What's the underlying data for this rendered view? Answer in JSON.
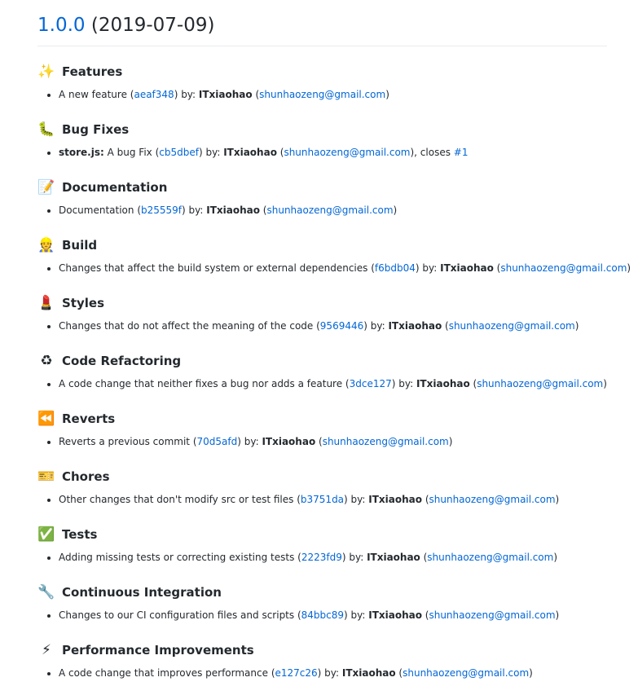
{
  "title": {
    "version": "1.0.0",
    "date": "(2019-07-09)"
  },
  "by_label": "by:",
  "closes_label": "closes",
  "link_color": "#0366d6",
  "sections": [
    {
      "icon": "sparkles-icon",
      "glyph": "✨",
      "heading": "Features",
      "items": [
        {
          "scope": "",
          "text": "A new feature",
          "hash": "aeaf348",
          "author": "ITxiaohao",
          "email": "shunhaozeng@gmail.com"
        }
      ]
    },
    {
      "icon": "bug-icon",
      "glyph": "🐛",
      "heading": "Bug Fixes",
      "items": [
        {
          "scope": "store.js:",
          "text": "A bug Fix",
          "hash": "cb5dbef",
          "author": "ITxiaohao",
          "email": "shunhaozeng@gmail.com",
          "closes": "#1"
        }
      ]
    },
    {
      "icon": "memo-icon",
      "glyph": "📝",
      "heading": "Documentation",
      "items": [
        {
          "scope": "",
          "text": "Documentation",
          "hash": "b25559f",
          "author": "ITxiaohao",
          "email": "shunhaozeng@gmail.com"
        }
      ]
    },
    {
      "icon": "construction-worker-icon",
      "glyph": "👷",
      "heading": "Build",
      "items": [
        {
          "scope": "",
          "text": "Changes that affect the build system or external dependencies",
          "hash": "f6bdb04",
          "author": "ITxiaohao",
          "email": "shunhaozeng@gmail.com"
        }
      ]
    },
    {
      "icon": "lipstick-icon",
      "glyph": "💄",
      "heading": "Styles",
      "items": [
        {
          "scope": "",
          "text": "Changes that do not affect the meaning of the code",
          "hash": "9569446",
          "author": "ITxiaohao",
          "email": "shunhaozeng@gmail.com"
        }
      ]
    },
    {
      "icon": "recycle-icon",
      "glyph": "♻",
      "heading": "Code Refactoring",
      "items": [
        {
          "scope": "",
          "text": "A code change that neither fixes a bug nor adds a feature",
          "hash": "3dce127",
          "author": "ITxiaohao",
          "email": "shunhaozeng@gmail.com"
        }
      ]
    },
    {
      "icon": "rewind-icon",
      "glyph": "⏪",
      "heading": "Reverts",
      "items": [
        {
          "scope": "",
          "text": "Reverts a previous commit",
          "hash": "70d5afd",
          "author": "ITxiaohao",
          "email": "shunhaozeng@gmail.com"
        }
      ]
    },
    {
      "icon": "ticket-icon",
      "glyph": "🎫",
      "heading": "Chores",
      "items": [
        {
          "scope": "",
          "text": "Other changes that don't modify src or test files",
          "hash": "b3751da",
          "author": "ITxiaohao",
          "email": "shunhaozeng@gmail.com"
        }
      ]
    },
    {
      "icon": "check-mark-icon",
      "glyph": "✅",
      "heading": "Tests",
      "items": [
        {
          "scope": "",
          "text": "Adding missing tests or correcting existing tests",
          "hash": "2223fd9",
          "author": "ITxiaohao",
          "email": "shunhaozeng@gmail.com"
        }
      ]
    },
    {
      "icon": "wrench-icon",
      "glyph": "🔧",
      "heading": "Continuous Integration",
      "items": [
        {
          "scope": "",
          "text": "Changes to our CI configuration files and scripts",
          "hash": "84bbc89",
          "author": "ITxiaohao",
          "email": "shunhaozeng@gmail.com"
        }
      ]
    },
    {
      "icon": "lightning-icon",
      "glyph": "⚡",
      "heading": "Performance Improvements",
      "items": [
        {
          "scope": "",
          "text": "A code change that improves performance",
          "hash": "e127c26",
          "author": "ITxiaohao",
          "email": "shunhaozeng@gmail.com"
        }
      ]
    }
  ]
}
